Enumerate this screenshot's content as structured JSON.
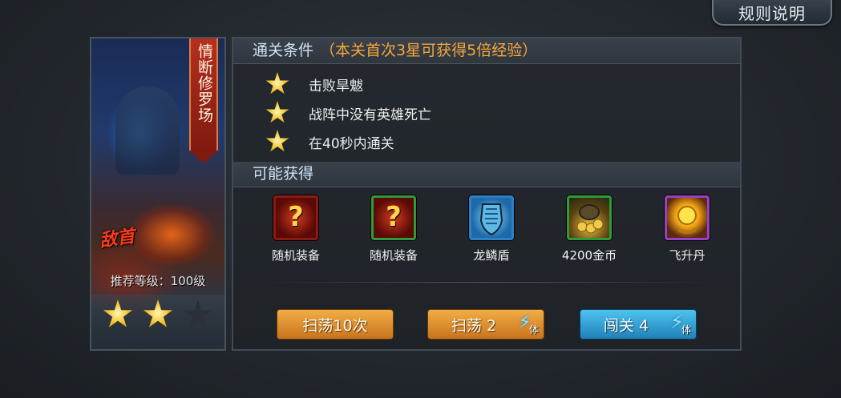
{
  "header": {
    "rules_button": "规则说明"
  },
  "stage": {
    "name": "情断修罗场",
    "boss_tag": "敌首",
    "recommended_level": "推荐等级：100级",
    "stars_earned": 2,
    "stars_total": 3
  },
  "clear_conditions": {
    "title": "通关条件",
    "bonus_note": "（本关首次3星可获得5倍经验）",
    "items": [
      {
        "text": "击败旱魃"
      },
      {
        "text": "战阵中没有英雄死亡"
      },
      {
        "text": "在40秒内通关"
      }
    ]
  },
  "rewards": {
    "title": "可能获得",
    "items": [
      {
        "label": "随机装备",
        "icon": "random-equipment-icon",
        "frame_color": "#8a1a14"
      },
      {
        "label": "随机装备",
        "icon": "random-equipment-icon",
        "frame_color": "#2f9a3a"
      },
      {
        "label": "龙鳞盾",
        "icon": "dragon-scale-shield-icon",
        "frame_color": "#2f7fc5"
      },
      {
        "label": "4200金币",
        "icon": "gold-coins-icon",
        "frame_color": "#2f9a3a"
      },
      {
        "label": "飞升丹",
        "icon": "ascension-pill-icon",
        "frame_color": "#9a40c8"
      }
    ]
  },
  "actions": {
    "sweep10": "扫荡10次",
    "sweep": "扫荡 2",
    "challenge": "闯关 4",
    "stamina_label": "体",
    "stamina_icon": "lightning-icon"
  },
  "colors": {
    "accent_orange": "#f4a73a",
    "header_blue": "#cfe3f7",
    "button_orange": "#e0922e",
    "button_blue": "#2f9fd6"
  }
}
